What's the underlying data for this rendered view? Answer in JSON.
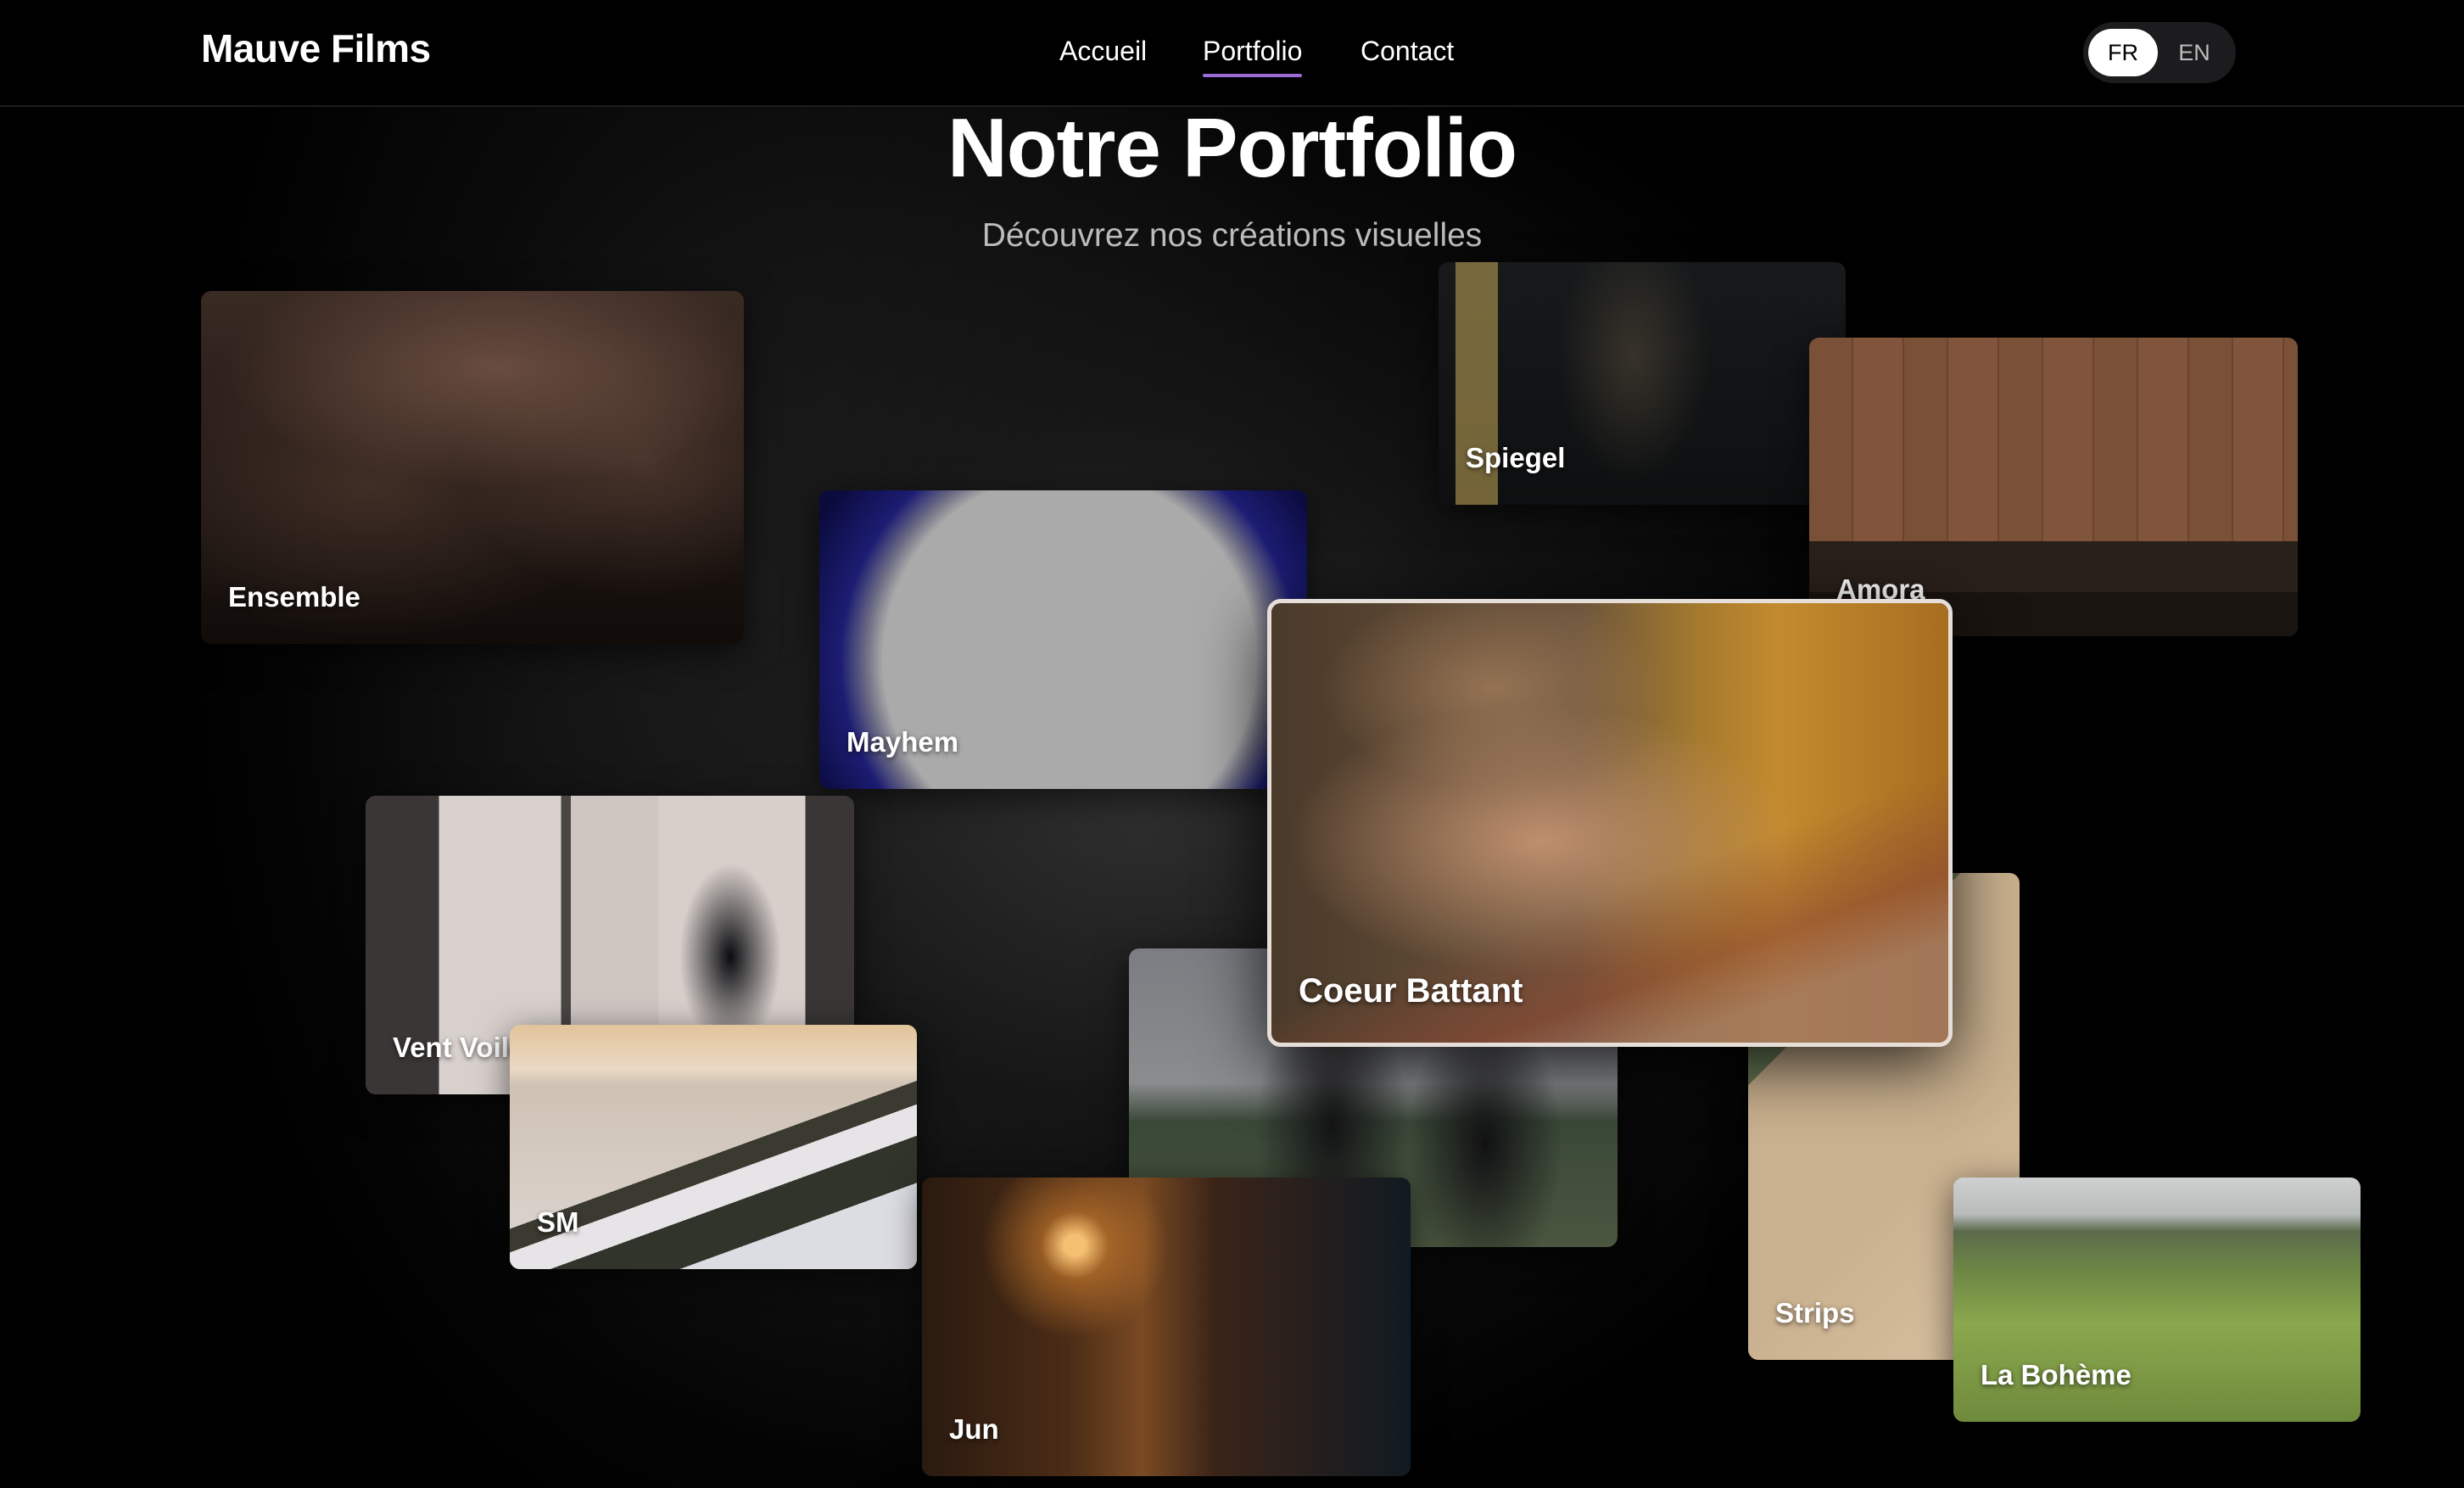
{
  "brand": {
    "name": "Mauve Films"
  },
  "nav": {
    "items": [
      {
        "label": "Accueil",
        "active": false
      },
      {
        "label": "Portfolio",
        "active": true
      },
      {
        "label": "Contact",
        "active": false
      }
    ],
    "accent_color": "#9b6bd6"
  },
  "language": {
    "options": [
      "FR",
      "EN"
    ],
    "selected": "FR"
  },
  "header": {
    "title": "Notre Portfolio",
    "subtitle": "Découvrez nos créations visuelles"
  },
  "projects": [
    {
      "title": "Ensemble"
    },
    {
      "title": "Mayhem"
    },
    {
      "title": "Spiegel"
    },
    {
      "title": "Amora"
    },
    {
      "title": "Coeur Battant",
      "highlighted": true
    },
    {
      "title": "Vent Voile"
    },
    {
      "title": "SM"
    },
    {
      "title": ""
    },
    {
      "title": "Jun"
    },
    {
      "title": "Strips"
    },
    {
      "title": "La Bohème"
    }
  ]
}
